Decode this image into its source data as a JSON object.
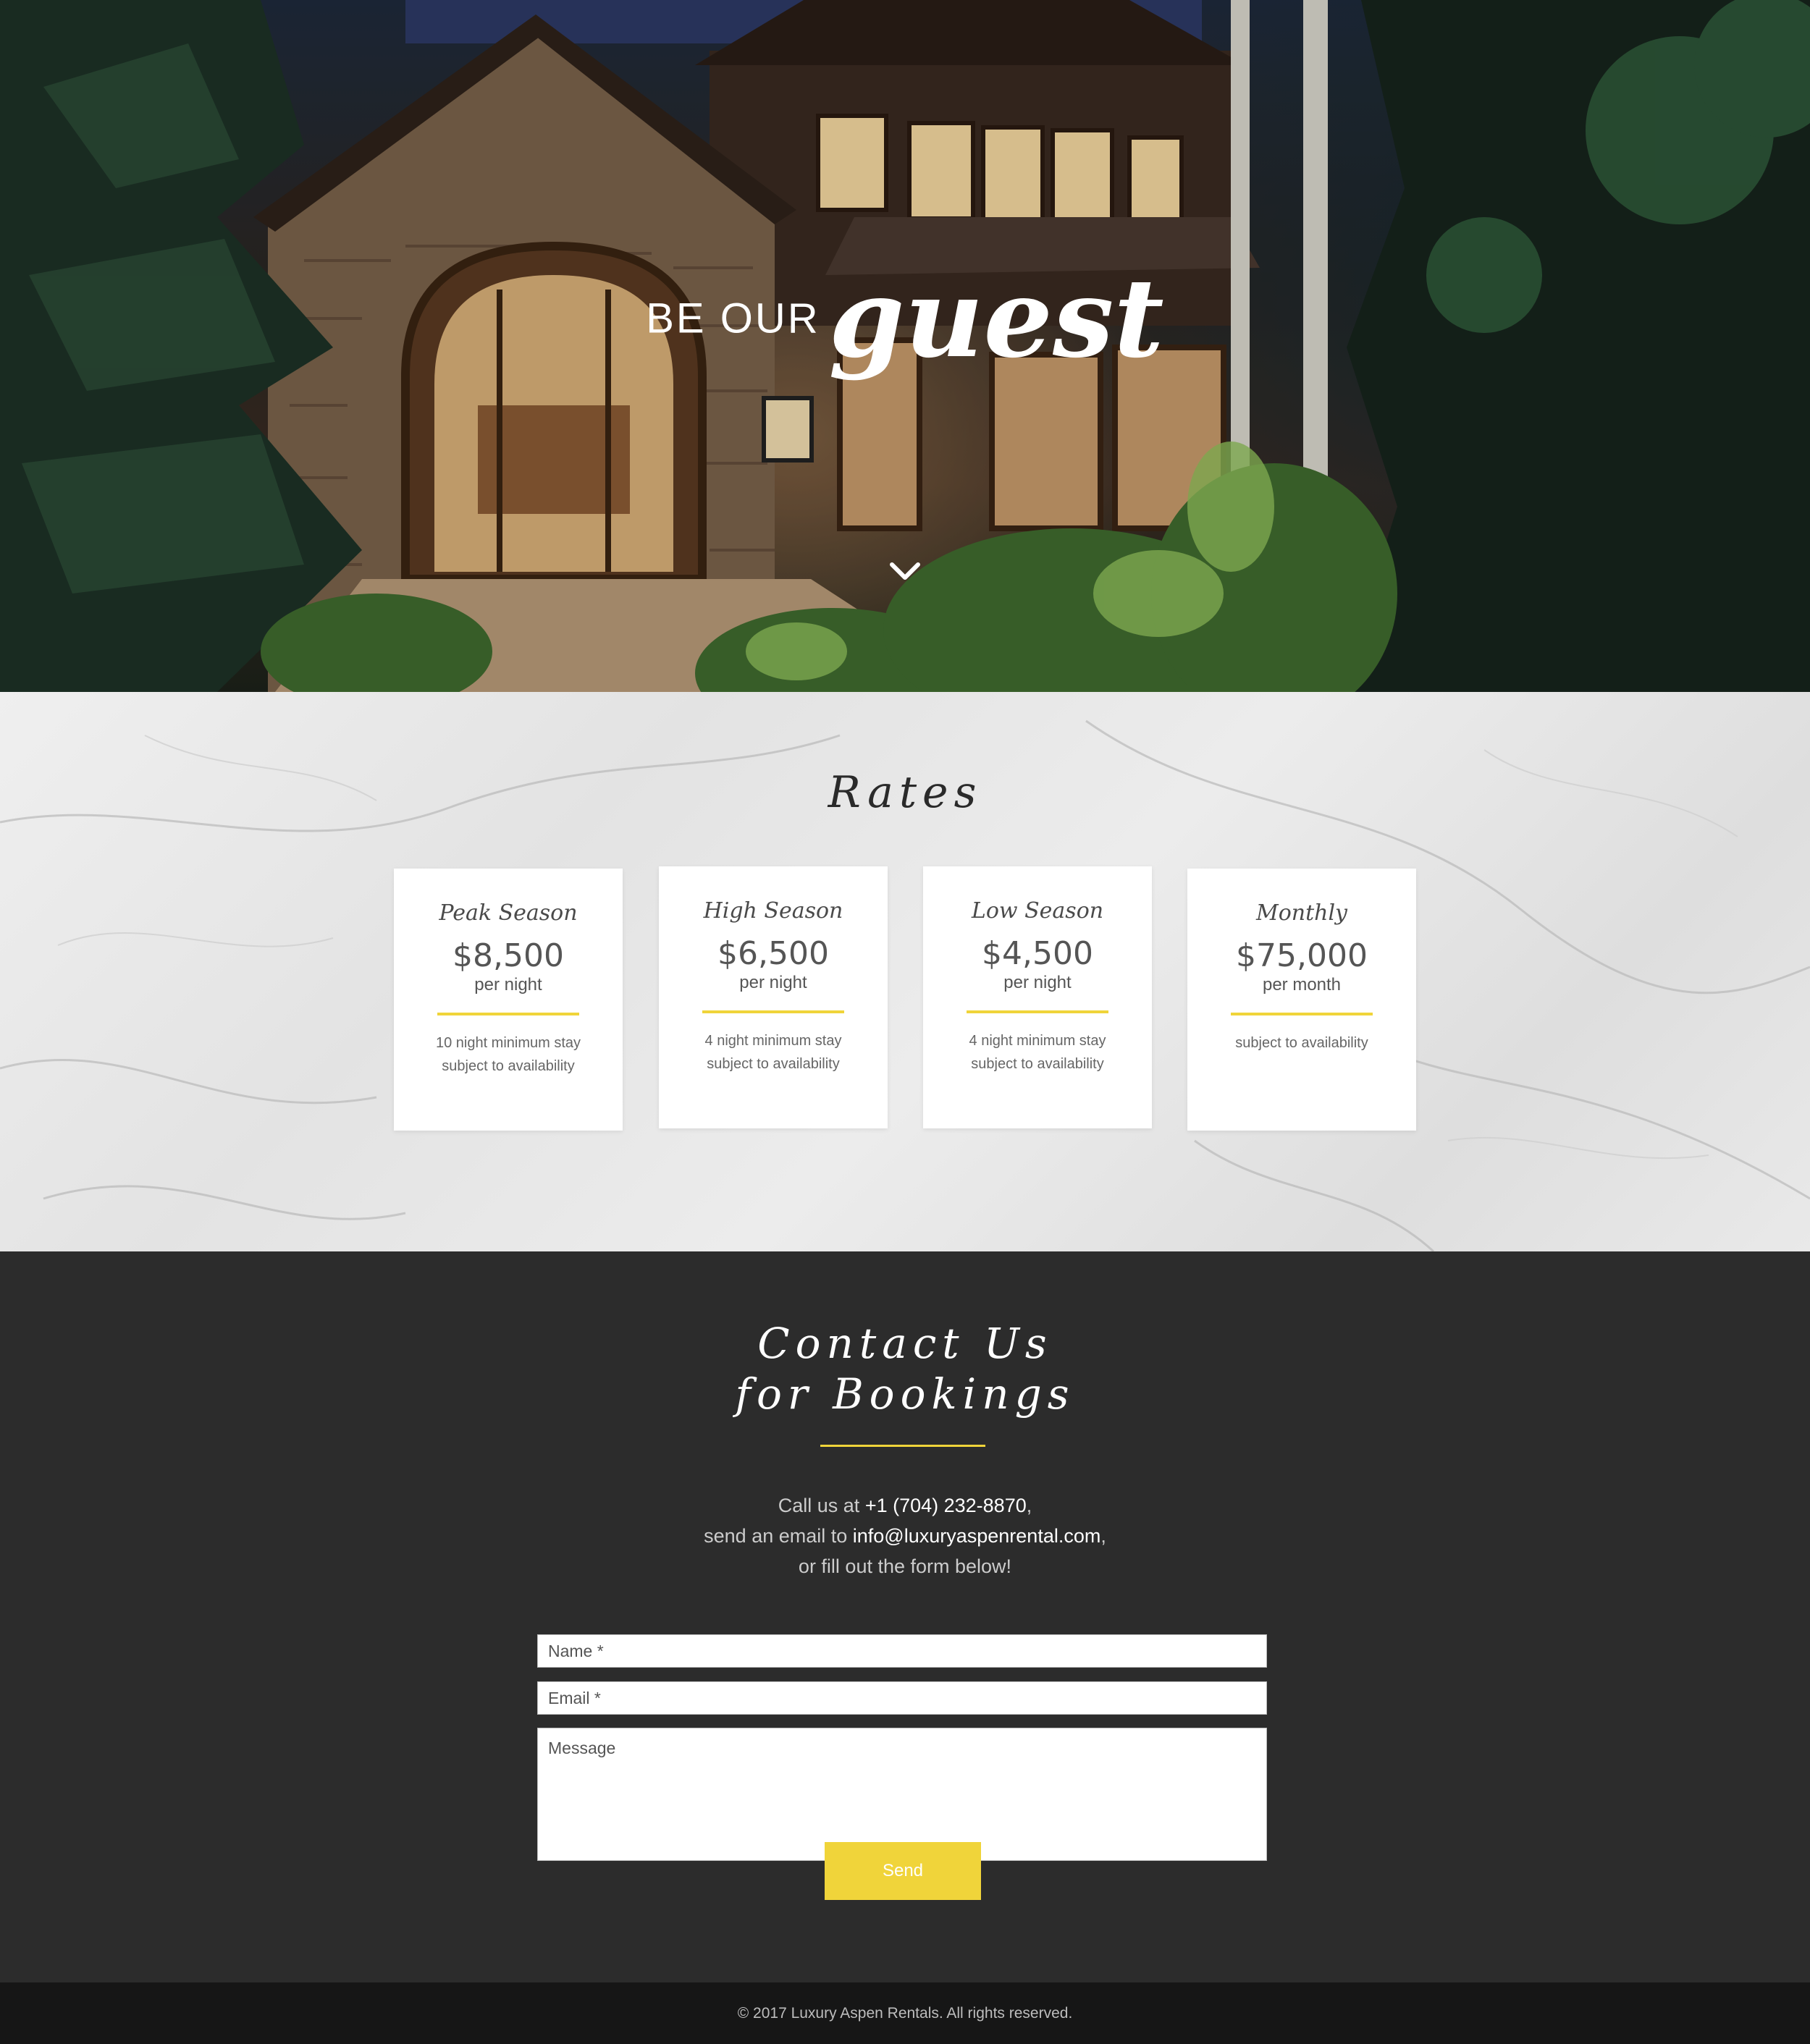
{
  "hero": {
    "title_lead": "BE OUR",
    "title_script": "guest",
    "scroll_icon": "chevron-down-icon"
  },
  "rates": {
    "title": "Rates",
    "cards": [
      {
        "name": "Peak Season",
        "price": "$8,500",
        "unit": "per night",
        "note_line1": "10 night minimum stay",
        "note_line2": "subject to availability"
      },
      {
        "name": "High Season",
        "price": "$6,500",
        "unit": "per night",
        "note_line1": "4 night minimum stay",
        "note_line2": "subject to availability"
      },
      {
        "name": "Low Season",
        "price": "$4,500",
        "unit": "per night",
        "note_line1": "4 night minimum stay",
        "note_line2": "subject to availability"
      },
      {
        "name": "Monthly",
        "price": "$75,000",
        "unit": "per month",
        "note_line1": "subject to availability",
        "note_line2": ""
      }
    ]
  },
  "contact": {
    "title_line1": "Contact Us",
    "title_line2": "for Bookings",
    "line1_prefix": "Call us at ",
    "phone": "+1 (704) 232-8870",
    "line1_suffix": ",",
    "line2_prefix": "send an email to ",
    "email": "info@luxuryaspenrental.com",
    "line2_suffix": ",",
    "line3": "or fill out the form below!",
    "form": {
      "name_placeholder": "Name *",
      "email_placeholder": "Email *",
      "message_placeholder": "Message",
      "send_label": "Send"
    }
  },
  "footer": {
    "copyright": "© 2017 Luxury Aspen Rentals.  All rights reserved."
  },
  "colors": {
    "accent_yellow": "#f0d43a",
    "contact_bg": "#2c2c2c",
    "footer_bg": "#161616"
  }
}
